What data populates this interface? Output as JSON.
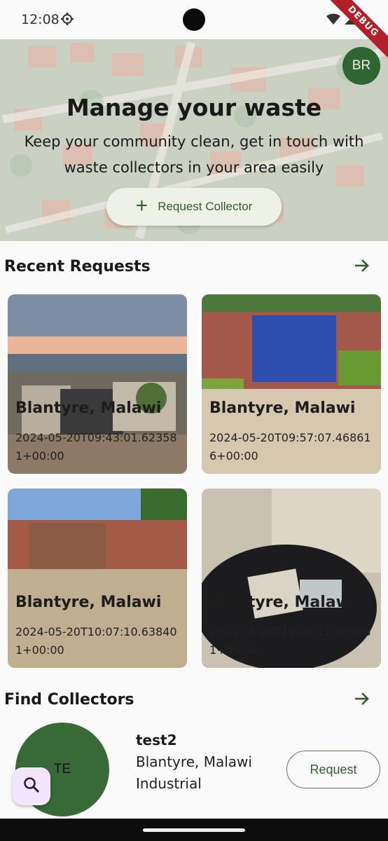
{
  "status_bar": {
    "time": "12:08",
    "debug_label": "DEBUG"
  },
  "hero": {
    "avatar_initials": "BR",
    "title": "Manage your waste",
    "subtitle": "Keep your community clean, get in touch with waste collectors in your area easily",
    "request_collector_label": "Request Collector"
  },
  "recent_requests": {
    "title": "Recent Requests",
    "items": [
      {
        "location": "Blantyre, Malawi",
        "date": "2024-05-20T09:43:01.623581+00:00"
      },
      {
        "location": "Blantyre, Malawi",
        "date": "2024-05-20T09:57:07.468616+00:00"
      },
      {
        "location": "Blantyre, Malawi",
        "date": "2024-05-20T10:07:10.638401+00:00"
      },
      {
        "location": "Blantyre, Malawi",
        "date": "2024-05-20T10:08:11.208981+00:00"
      }
    ]
  },
  "find_collectors": {
    "title": "Find Collectors",
    "collector": {
      "initials": "TE",
      "name": "test2",
      "location": "Blantyre, Malawi",
      "type": "Industrial",
      "request_label": "Request"
    }
  },
  "colors": {
    "primary": "#2f5d2f",
    "avatar": "#2f6530",
    "fab": "#f1e6fb",
    "debug": "#b31e28"
  },
  "icons": [
    "settings-icon",
    "wifi-icon",
    "signal-icon",
    "battery-icon",
    "add-icon",
    "arrow-forward-icon",
    "search-icon"
  ]
}
